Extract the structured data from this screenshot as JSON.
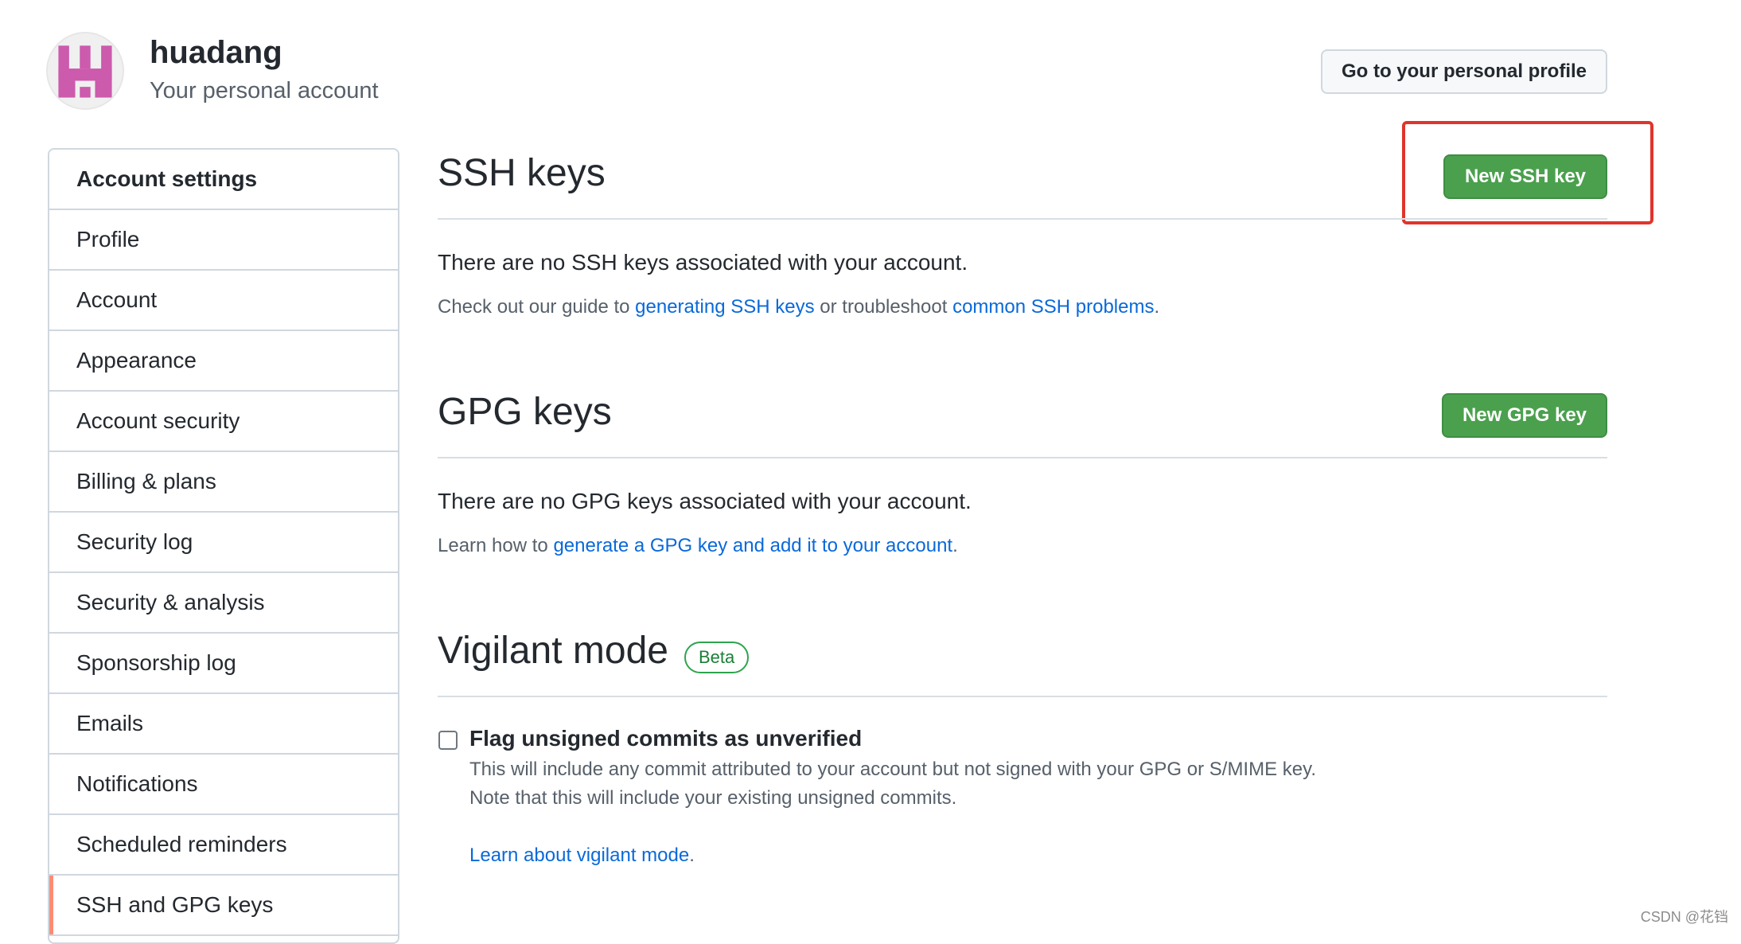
{
  "header": {
    "username": "huadang",
    "subtitle": "Your personal account",
    "profile_button": "Go to your personal profile"
  },
  "sidebar": {
    "heading": "Account settings",
    "items": [
      {
        "label": "Profile"
      },
      {
        "label": "Account"
      },
      {
        "label": "Appearance"
      },
      {
        "label": "Account security"
      },
      {
        "label": "Billing & plans"
      },
      {
        "label": "Security log"
      },
      {
        "label": "Security & analysis"
      },
      {
        "label": "Sponsorship log"
      },
      {
        "label": "Emails"
      },
      {
        "label": "Notifications"
      },
      {
        "label": "Scheduled reminders"
      },
      {
        "label": "SSH and GPG keys",
        "selected": true
      }
    ]
  },
  "ssh": {
    "title": "SSH keys",
    "new_button": "New SSH key",
    "empty": "There are no SSH keys associated with your account.",
    "guide_prefix": "Check out our guide to ",
    "guide_link": "generating SSH keys",
    "guide_middle": " or troubleshoot ",
    "guide_link2": "common SSH problems",
    "guide_suffix": "."
  },
  "gpg": {
    "title": "GPG keys",
    "new_button": "New GPG key",
    "empty": "There are no GPG keys associated with your account.",
    "learn_prefix": "Learn how to ",
    "learn_link": "generate a GPG key and add it to your account",
    "learn_suffix": "."
  },
  "vigilant": {
    "title": "Vigilant mode",
    "badge": "Beta",
    "checkbox_label": "Flag unsigned commits as unverified",
    "desc_line1": "This will include any commit attributed to your account but not signed with your GPG or S/MIME key.",
    "desc_line2": "Note that this will include your existing unsigned commits.",
    "learn_link": "Learn about vigilant mode",
    "learn_suffix": "."
  },
  "watermark": "CSDN @花铛",
  "colors": {
    "green_button": "#4ba04e",
    "link": "#0969da",
    "highlight_box": "#e0352b",
    "selected_indicator": "#fd8c73"
  }
}
